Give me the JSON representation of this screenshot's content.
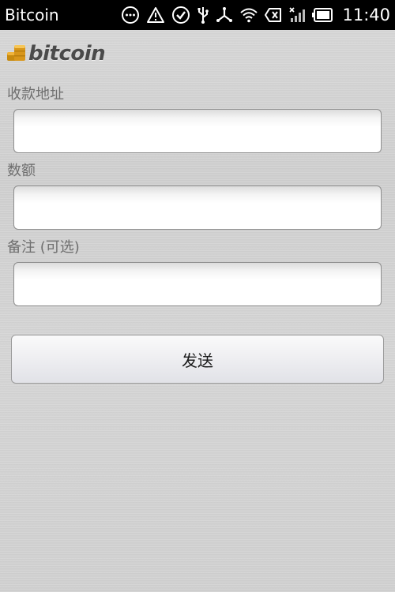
{
  "status_bar": {
    "app_title": "Bitcoin",
    "time": "11:40",
    "icons": [
      "more-circle-icon",
      "warning-icon",
      "check-circle-icon",
      "usb-icon",
      "share-icon",
      "wifi-icon",
      "no-sim-icon",
      "signal-icon",
      "battery-icon"
    ]
  },
  "logo": {
    "text": "bitcoin"
  },
  "form": {
    "address_label": "收款地址",
    "address_value": "",
    "amount_label": "数额",
    "amount_value": "",
    "note_label": "备注 (可选)",
    "note_value": "",
    "send_label": "发送"
  },
  "colors": {
    "status_bar_bg": "#000000",
    "logo_coin": "#e8a317",
    "label_text": "#6e6e6e"
  }
}
